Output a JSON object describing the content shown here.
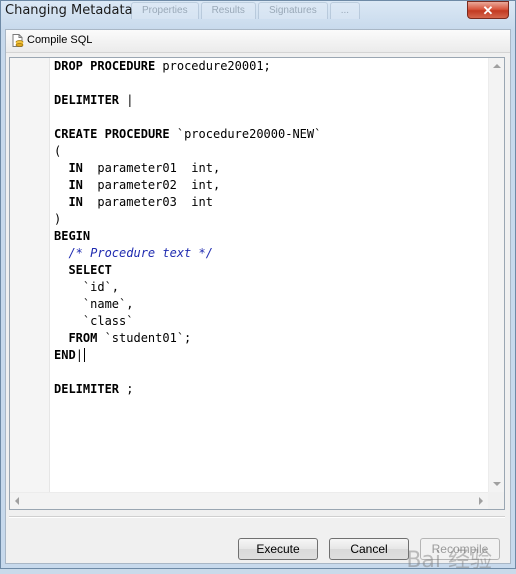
{
  "window": {
    "title": "Changing Metadata",
    "close_glyph": "✕",
    "background_tabs": [
      "Properties",
      "Results",
      "Signatures",
      "..."
    ]
  },
  "toolbar": {
    "compile_label": "Compile SQL",
    "compile_icon": "document-database-icon"
  },
  "editor": {
    "lines": [
      "DROP PROCEDURE procedure20001;",
      "",
      "DELIMITER |",
      "",
      "CREATE PROCEDURE `procedure20000-NEW`",
      "(",
      "  IN  parameter01  int,",
      "  IN  parameter02  int,",
      "  IN  parameter03  int",
      ")",
      "BEGIN",
      "  /* Procedure text */",
      "  SELECT",
      "    `id`,",
      "    `name`,",
      "    `class`",
      "  FROM `student01`;",
      "END|",
      "",
      "DELIMITER ;"
    ]
  },
  "buttons": {
    "execute_label": "Execute",
    "cancel_label": "Cancel",
    "recompile_label": "Recompile"
  },
  "watermark": "Bai 经验",
  "colors": {
    "comment": "#1f2bb0",
    "close_button": "#c23a22",
    "window_frame": "#c7d9ec"
  }
}
